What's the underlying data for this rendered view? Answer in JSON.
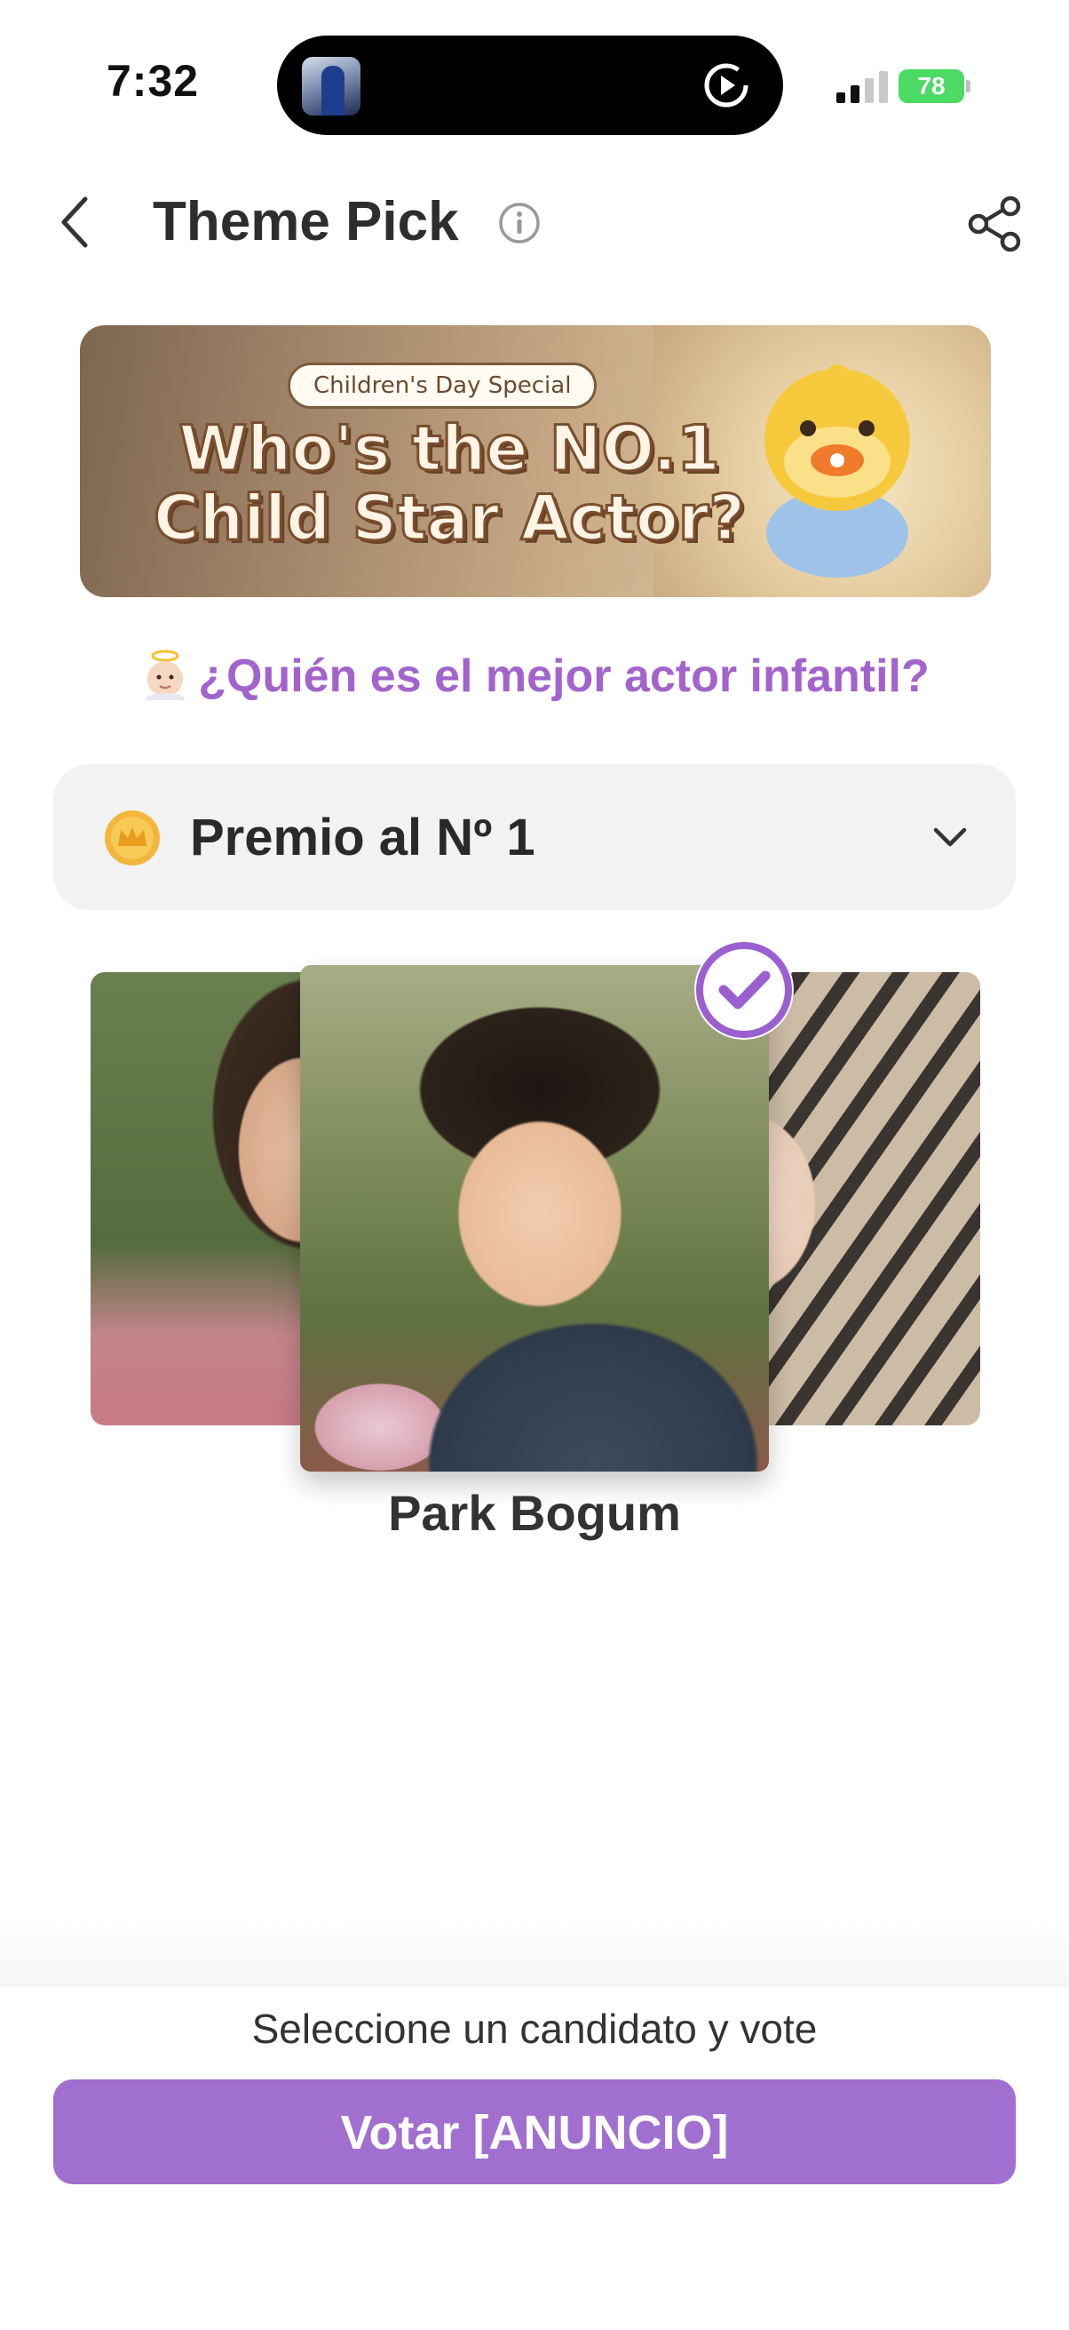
{
  "status_bar": {
    "time": "7:32",
    "battery": "78",
    "battery_color": "#4cd964"
  },
  "header": {
    "title": "Theme Pick",
    "back_icon": "chevron-left-icon",
    "info_icon": "info-icon",
    "share_icon": "share-icon"
  },
  "banner": {
    "tag": "Children's Day Special",
    "title": "Who's the NO.1\nChild Star Actor?"
  },
  "subtitle": {
    "emoji": "angel-baby-icon",
    "text": "¿Quién es el mejor actor infantil?",
    "color": "#a264cc"
  },
  "award": {
    "label": "Premio al Nº 1",
    "icon": "crown-coin-icon"
  },
  "candidates": {
    "selected_name": "Park Bogum",
    "check_icon": "check-circle-icon"
  },
  "footer": {
    "hint": "Seleccione un candidato y vote",
    "vote_label": "Votar [ANUNCIO]",
    "accent_color": "#a16fd0"
  }
}
